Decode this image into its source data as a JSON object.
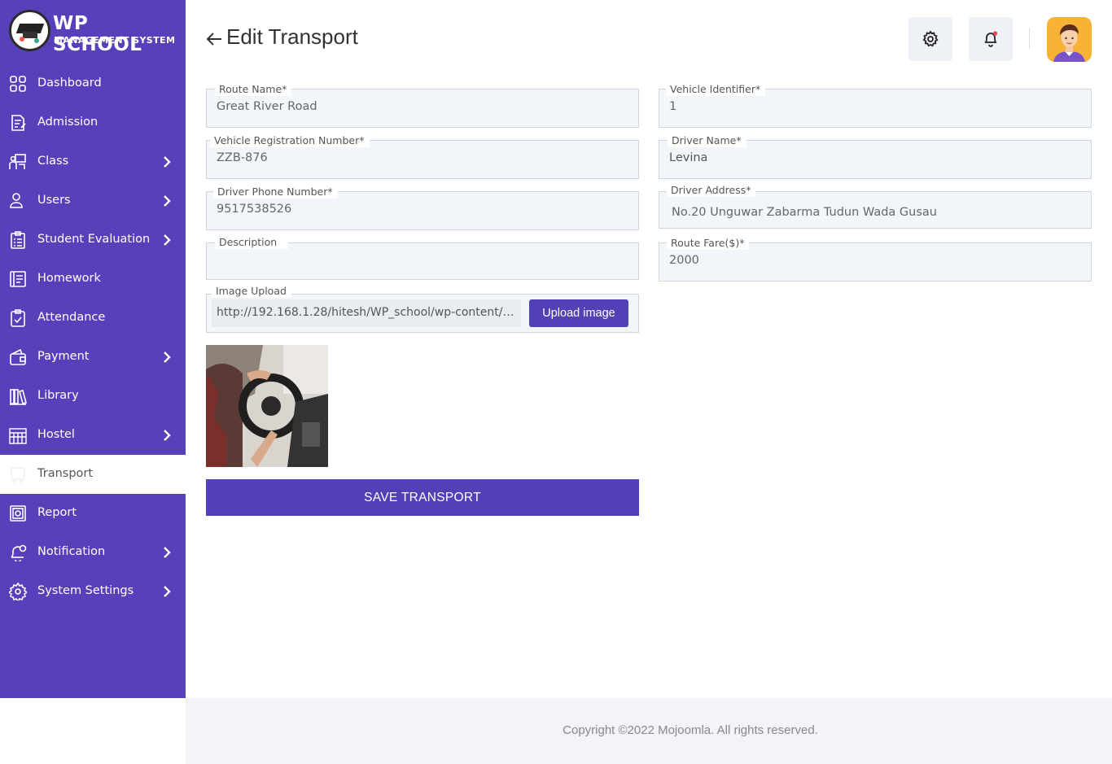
{
  "brand": {
    "title": "WP SCHOOL",
    "subtitle": "MANAGEMENT SYSTEM"
  },
  "sidebar": {
    "items": [
      {
        "label": "Dashboard",
        "icon": "dashboard-icon",
        "has_submenu": false
      },
      {
        "label": "Admission",
        "icon": "admission-icon",
        "has_submenu": false
      },
      {
        "label": "Class",
        "icon": "class-icon",
        "has_submenu": true
      },
      {
        "label": "Users",
        "icon": "user-icon",
        "has_submenu": true
      },
      {
        "label": "Student Evaluation",
        "icon": "evaluation-icon",
        "has_submenu": true
      },
      {
        "label": "Homework",
        "icon": "homework-icon",
        "has_submenu": false
      },
      {
        "label": "Attendance",
        "icon": "attendance-icon",
        "has_submenu": false
      },
      {
        "label": "Payment",
        "icon": "wallet-icon",
        "has_submenu": true
      },
      {
        "label": "Library",
        "icon": "library-icon",
        "has_submenu": false
      },
      {
        "label": "Hostel",
        "icon": "hostel-icon",
        "has_submenu": true
      },
      {
        "label": "Transport",
        "icon": "transport-icon",
        "has_submenu": false,
        "active": true
      },
      {
        "label": "Report",
        "icon": "report-icon",
        "has_submenu": false
      },
      {
        "label": "Notification",
        "icon": "notification-icon",
        "has_submenu": true
      },
      {
        "label": "System Settings",
        "icon": "gear-icon",
        "has_submenu": true
      }
    ]
  },
  "header": {
    "title": "Edit Transport"
  },
  "form": {
    "route_name": {
      "label": "Route Name*",
      "value": "Great River Road"
    },
    "vehicle_identifier": {
      "label": "Vehicle Identifier*",
      "value": "1"
    },
    "vehicle_registration": {
      "label": "Vehicle Registration Number*",
      "value": "ZZB-876"
    },
    "driver_name": {
      "label": "Driver Name*",
      "value": "Levina"
    },
    "driver_phone": {
      "label": "Driver Phone Number*",
      "value": "9517538526"
    },
    "driver_address": {
      "label": "Driver Address*",
      "value": "No.20 Unguwar Zabarma Tudun Wada Gusau"
    },
    "description": {
      "label": "Description",
      "value": ""
    },
    "route_fare": {
      "label": "Route Fare($)*",
      "value": "2000"
    },
    "image_upload": {
      "label": "Image Upload",
      "value": "http://192.168.1.28/hitesh/WP_school/wp-content/u...",
      "button": "Upload image"
    },
    "save_label": "SAVE TRANSPORT"
  },
  "footer": {
    "text": "Copyright ©2022 Mojoomla. All rights reserved."
  },
  "colors": {
    "sidebar": "#5840bb",
    "accent": "#5240b6",
    "field_bg": "#f2f5fa",
    "notification_dot": "#e5484d"
  }
}
